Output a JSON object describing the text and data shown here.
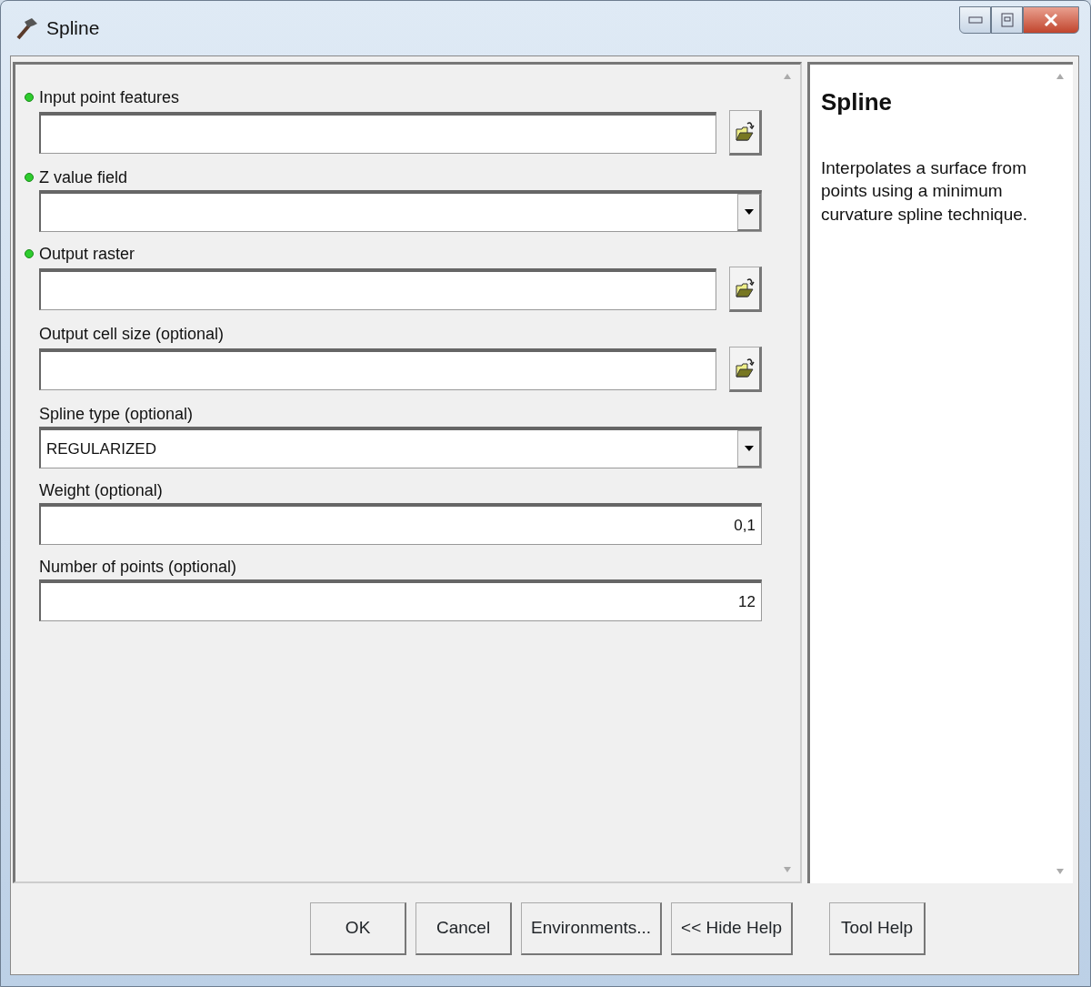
{
  "window": {
    "title": "Spline"
  },
  "parameters": [
    {
      "label": "Input point features",
      "required": true,
      "kind": "browse"
    },
    {
      "label": "Z value field",
      "required": true,
      "kind": "dropdown"
    },
    {
      "label": "Output raster",
      "required": true,
      "kind": "browse"
    },
    {
      "label": "Output cell size (optional)",
      "required": false,
      "kind": "browse"
    },
    {
      "label": "Spline type (optional)",
      "required": false,
      "kind": "dropdown",
      "value": "REGULARIZED"
    },
    {
      "label": "Weight (optional)",
      "required": false,
      "kind": "text",
      "value": "0,1"
    },
    {
      "label": "Number of points (optional)",
      "required": false,
      "kind": "text",
      "value": "12"
    }
  ],
  "help": {
    "title": "Spline",
    "text": "Interpolates a surface from points using a minimum curvature spline technique."
  },
  "buttons": [
    "OK",
    "Cancel",
    "Environments...",
    "<< Hide Help",
    "Tool Help"
  ]
}
